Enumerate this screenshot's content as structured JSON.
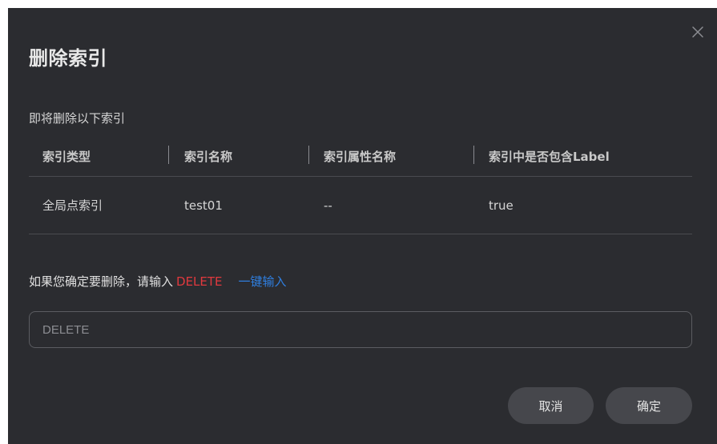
{
  "dialog": {
    "title": "删除索引",
    "description": "即将删除以下索引",
    "close_icon": "close-icon",
    "table": {
      "headers": [
        "索引类型",
        "索引名称",
        "索引属性名称",
        "索引中是否包含Label"
      ],
      "rows": [
        [
          "全局点索引",
          "test01",
          "--",
          "true"
        ]
      ]
    },
    "confirm": {
      "prompt": "如果您确定要删除，请输入",
      "keyword": "DELETE",
      "quick_input_link": "一键输入"
    },
    "input": {
      "placeholder": "DELETE",
      "value": ""
    },
    "buttons": {
      "cancel": "取消",
      "ok": "确定"
    }
  },
  "colors": {
    "dialog_bg": "#2b2c30",
    "keyword_red": "#e0393e",
    "link_blue": "#2f7fe0",
    "button_bg": "#46474c"
  }
}
